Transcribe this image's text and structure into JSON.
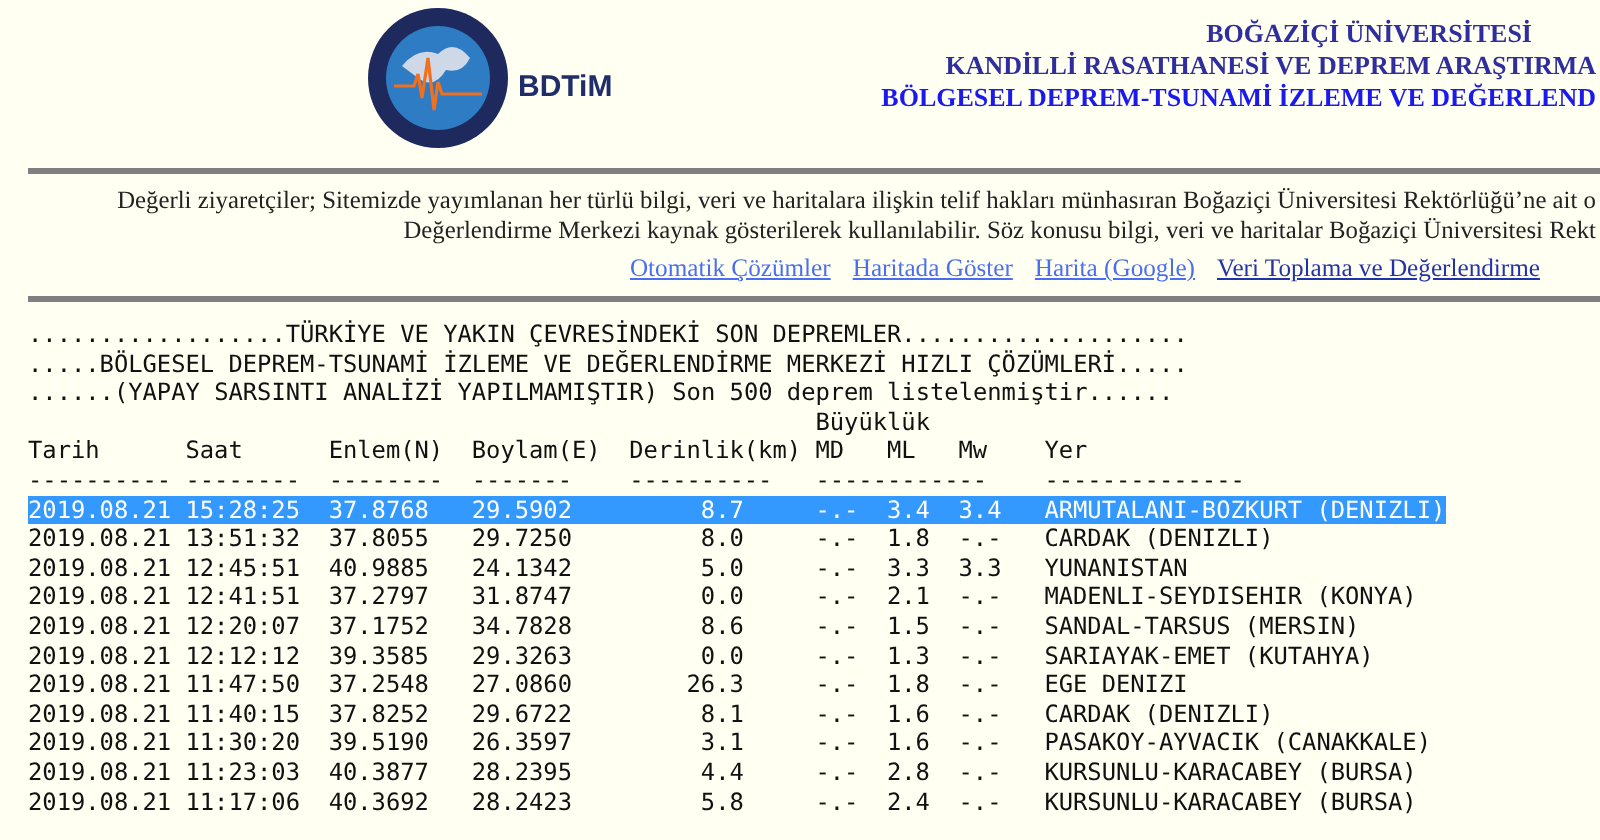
{
  "header": {
    "logo_text": "BDTiM",
    "titles": [
      "BOĞAZİÇİ ÜNİVERSİTESİ",
      "KANDİLLİ RASATHANESİ VE DEPREM ARAŞTIRMA",
      "BÖLGESEL DEPREM-TSUNAMİ İZLEME VE DEĞERLEND"
    ]
  },
  "notice": [
    "Değerli ziyaretçiler; Sitemizde yayımlanan her türlü bilgi, veri ve haritalara ilişkin telif hakları münhasıran Boğaziçi Üniversitesi Rektörlüğü’ne ait o",
    "Değerlendirme Merkezi kaynak gösterilerek kullanılabilir. Söz konusu bilgi, veri ve haritalar Boğaziçi Üniversitesi Rekt"
  ],
  "links": [
    {
      "label": "Otomatik Çözümler",
      "visited": false
    },
    {
      "label": "Haritada Göster",
      "visited": false
    },
    {
      "label": "Harita (Google)",
      "visited": false
    },
    {
      "label": "Veri Toplama ve Değerlendirme",
      "visited": true
    }
  ],
  "listing": {
    "headlines": [
      "..................TÜRKİYE VE YAKIN ÇEVRESİNDEKİ SON DEPREMLER....................",
      ".....BÖLGESEL DEPREM-TSUNAMİ İZLEME VE DEĞERLENDİRME MERKEZİ HIZLI ÇÖZÜMLERİ.....",
      "......(YAPAY SARSINTI ANALİZİ YAPILMAMIŞTIR) Son 500 deprem listelenmiştir......"
    ],
    "group_heading": "Büyüklük",
    "columns": [
      "Tarih",
      "Saat",
      "Enlem(N)",
      "Boylam(E)",
      "Derinlik(km)",
      "MD",
      "ML",
      "Mw",
      "Yer"
    ],
    "rules": [
      "----------",
      "--------",
      "--------",
      "-------",
      "----------",
      "------------",
      "--------------"
    ],
    "rows": [
      {
        "date": "2019.08.21",
        "time": "15:28:25",
        "lat": "37.8768",
        "lon": "29.5902",
        "depth": "8.7",
        "md": "-.-",
        "ml": "3.4",
        "mw": "3.4",
        "place": "ARMUTALANI-BOZKURT (DENIZLI)",
        "selected": true
      },
      {
        "date": "2019.08.21",
        "time": "13:51:32",
        "lat": "37.8055",
        "lon": "29.7250",
        "depth": "8.0",
        "md": "-.-",
        "ml": "1.8",
        "mw": "-.-",
        "place": "CARDAK (DENIZLI)",
        "selected": false
      },
      {
        "date": "2019.08.21",
        "time": "12:45:51",
        "lat": "40.9885",
        "lon": "24.1342",
        "depth": "5.0",
        "md": "-.-",
        "ml": "3.3",
        "mw": "3.3",
        "place": "YUNANISTAN",
        "selected": false
      },
      {
        "date": "2019.08.21",
        "time": "12:41:51",
        "lat": "37.2797",
        "lon": "31.8747",
        "depth": "0.0",
        "md": "-.-",
        "ml": "2.1",
        "mw": "-.-",
        "place": "MADENLI-SEYDISEHIR (KONYA)",
        "selected": false
      },
      {
        "date": "2019.08.21",
        "time": "12:20:07",
        "lat": "37.1752",
        "lon": "34.7828",
        "depth": "8.6",
        "md": "-.-",
        "ml": "1.5",
        "mw": "-.-",
        "place": "SANDAL-TARSUS (MERSIN)",
        "selected": false
      },
      {
        "date": "2019.08.21",
        "time": "12:12:12",
        "lat": "39.3585",
        "lon": "29.3263",
        "depth": "0.0",
        "md": "-.-",
        "ml": "1.3",
        "mw": "-.-",
        "place": "SARIAYAK-EMET (KUTAHYA)",
        "selected": false
      },
      {
        "date": "2019.08.21",
        "time": "11:47:50",
        "lat": "37.2548",
        "lon": "27.0860",
        "depth": "26.3",
        "md": "-.-",
        "ml": "1.8",
        "mw": "-.-",
        "place": "EGE DENIZI",
        "selected": false
      },
      {
        "date": "2019.08.21",
        "time": "11:40:15",
        "lat": "37.8252",
        "lon": "29.6722",
        "depth": "8.1",
        "md": "-.-",
        "ml": "1.6",
        "mw": "-.-",
        "place": "CARDAK (DENIZLI)",
        "selected": false
      },
      {
        "date": "2019.08.21",
        "time": "11:30:20",
        "lat": "39.5190",
        "lon": "26.3597",
        "depth": "3.1",
        "md": "-.-",
        "ml": "1.6",
        "mw": "-.-",
        "place": "PASAKOY-AYVACIK (CANAKKALE)",
        "selected": false
      },
      {
        "date": "2019.08.21",
        "time": "11:23:03",
        "lat": "40.3877",
        "lon": "28.2395",
        "depth": "4.4",
        "md": "-.-",
        "ml": "2.8",
        "mw": "-.-",
        "place": "KURSUNLU-KARACABEY (BURSA)",
        "selected": false
      },
      {
        "date": "2019.08.21",
        "time": "11:17:06",
        "lat": "40.3692",
        "lon": "28.2423",
        "depth": "5.8",
        "md": "-.-",
        "ml": "2.4",
        "mw": "-.-",
        "place": "KURSUNLU-KARACABEY (BURSA)",
        "selected": false
      }
    ]
  }
}
